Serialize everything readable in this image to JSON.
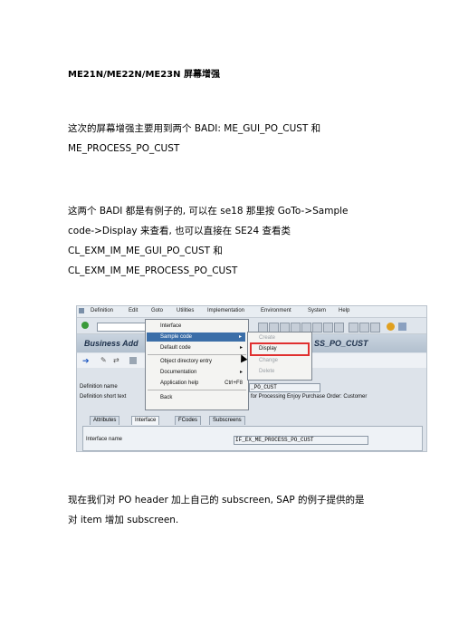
{
  "doc": {
    "title": "ME21N/ME22N/ME23N 屏幕增强",
    "para1_line1": "这次的屏幕增强主要用到两个 BADI: ME_GUI_PO_CUST 和",
    "para1_line2": "ME_PROCESS_PO_CUST",
    "para2_line1": "这两个 BADI 都是有例子的, 可以在 se18 那里按 GoTo->Sample",
    "para2_line2": "code->Display 来查看, 也可以直接在 SE24 查看类",
    "para2_line3": "CL_EXM_IM_ME_GUI_PO_CUST 和",
    "para2_line4": "CL_EXM_IM_ME_PROCESS_PO_CUST",
    "para3_line1": "现在我们对 PO header 加上自己的 subscreen, SAP 的例子提供的是",
    "para3_line2": "对 item 增加 subscreen."
  },
  "sap": {
    "menubar": [
      "Definition",
      "Edit",
      "Goto",
      "Utilities",
      "Implementation",
      "Environment",
      "System",
      "Help"
    ],
    "title_left": "Business Add",
    "title_right": "SS_PO_CUST",
    "def_name_label": "Definition name",
    "def_name_value": "_PO_CUST",
    "def_short_label": "Definition short text",
    "def_short_value": "for Processing Enjoy Purchase Order: Customer",
    "tabs": [
      "Attributes",
      "Interface",
      "FCodes",
      "Subscreens"
    ],
    "interface_label": "Interface name",
    "interface_value": "IF_EX_ME_PROCESS_PO_CUST",
    "goto_menu": [
      {
        "label": "Interface",
        "arrow": ""
      },
      {
        "label": "Sample code",
        "arrow": "▸"
      },
      {
        "label": "Default code",
        "arrow": "▸"
      },
      {
        "label": "Object directory entry",
        "arrow": ""
      },
      {
        "label": "Documentation",
        "arrow": "▸"
      },
      {
        "label": "Application help",
        "shortcut": "Ctrl+F8"
      },
      {
        "label": "Back",
        "arrow": ""
      }
    ],
    "sample_submenu": [
      "Create",
      "Display",
      "Change",
      "Delete"
    ]
  }
}
